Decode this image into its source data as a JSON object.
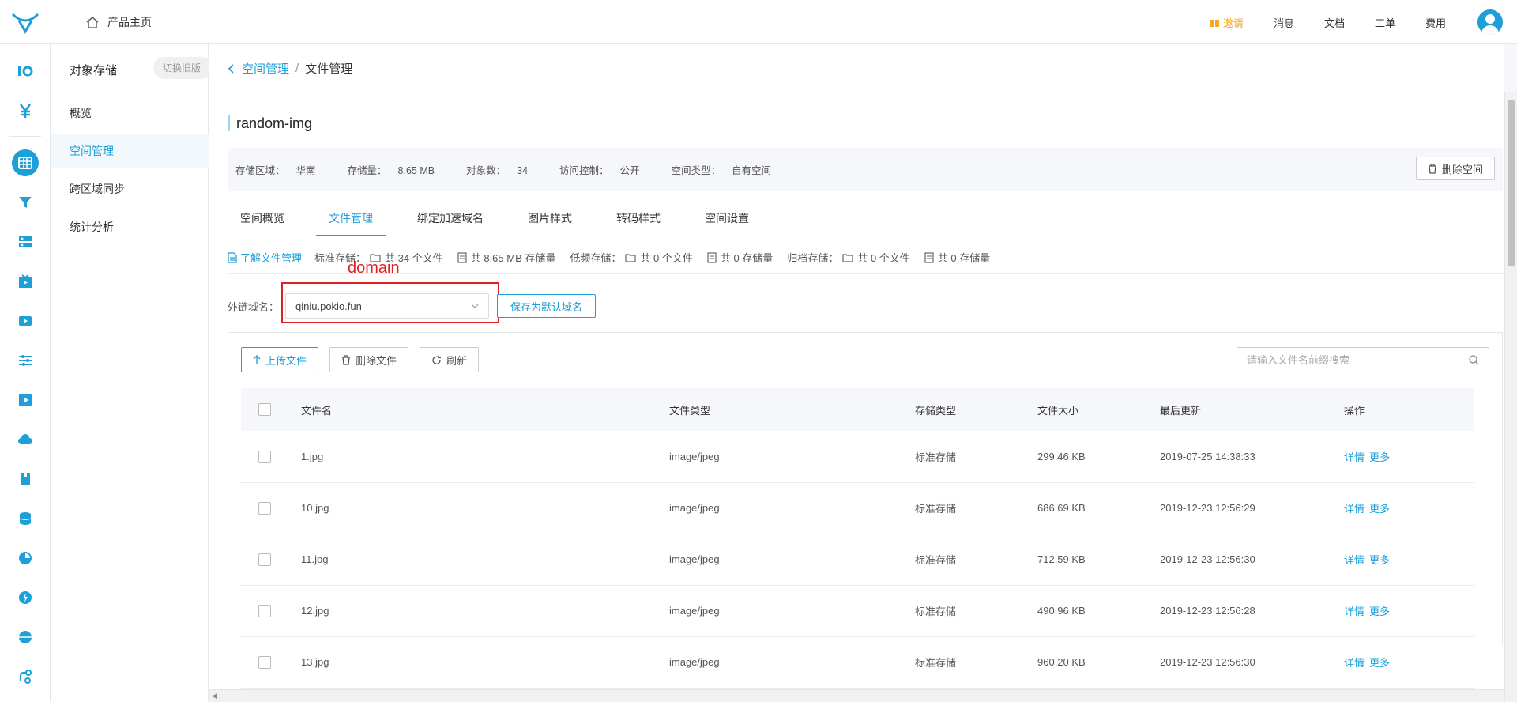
{
  "topbar": {
    "home_label": "产品主页",
    "invite_label": "邀请",
    "messages_label": "消息",
    "docs_label": "文档",
    "ticket_label": "工单",
    "billing_label": "费用"
  },
  "sidebar": {
    "title": "对象存储",
    "switch_label": "切换旧版",
    "items": [
      {
        "label": "概览"
      },
      {
        "label": "空间管理"
      },
      {
        "label": "跨区域同步"
      },
      {
        "label": "统计分析"
      }
    ]
  },
  "breadcrumb": {
    "parent": "空间管理",
    "separator": "/",
    "current": "文件管理"
  },
  "bucket": {
    "name": "random-img",
    "region_label": "存储区域：",
    "region_value": "华南",
    "storage_label": "存储量：",
    "storage_value": "8.65 MB",
    "objects_label": "对象数：",
    "objects_value": "34",
    "access_label": "访问控制：",
    "access_value": "公开",
    "type_label": "空间类型：",
    "type_value": "自有空间",
    "delete_button": "删除空间"
  },
  "tabs": [
    {
      "label": "空间概览"
    },
    {
      "label": "文件管理"
    },
    {
      "label": "绑定加速域名"
    },
    {
      "label": "图片样式"
    },
    {
      "label": "转码样式"
    },
    {
      "label": "空间设置"
    }
  ],
  "stats": {
    "learn_link": "了解文件管理",
    "standard_label": "标准存储：",
    "standard_files": "共 34 个文件",
    "standard_size": "共 8.65 MB 存储量",
    "low_label": "低频存储：",
    "low_files": "共 0 个文件",
    "low_size": "共 0 存储量",
    "archive_label": "归档存储：",
    "archive_files": "共 0 个文件",
    "archive_size": "共 0 存储量"
  },
  "domain": {
    "annotation": "domain",
    "label": "外链域名：",
    "value": "qiniu.pokio.fun",
    "save_default_button": "保存为默认域名"
  },
  "toolbar": {
    "upload_label": "上传文件",
    "delete_label": "删除文件",
    "refresh_label": "刷新",
    "search_placeholder": "请输入文件名前缀搜索"
  },
  "table": {
    "headers": [
      "文件名",
      "文件类型",
      "存储类型",
      "文件大小",
      "最后更新",
      "操作"
    ],
    "rows": [
      {
        "name": "1.jpg",
        "type": "image/jpeg",
        "storage": "标准存储",
        "size": "299.46 KB",
        "updated": "2019-07-25 14:38:33",
        "op_detail": "详情",
        "op_more": "更多"
      },
      {
        "name": "10.jpg",
        "type": "image/jpeg",
        "storage": "标准存储",
        "size": "686.69 KB",
        "updated": "2019-12-23 12:56:29",
        "op_detail": "详情",
        "op_more": "更多"
      },
      {
        "name": "11.jpg",
        "type": "image/jpeg",
        "storage": "标准存储",
        "size": "712.59 KB",
        "updated": "2019-12-23 12:56:30",
        "op_detail": "详情",
        "op_more": "更多"
      },
      {
        "name": "12.jpg",
        "type": "image/jpeg",
        "storage": "标准存储",
        "size": "490.96 KB",
        "updated": "2019-12-23 12:56:28",
        "op_detail": "详情",
        "op_more": "更多"
      },
      {
        "name": "13.jpg",
        "type": "image/jpeg",
        "storage": "标准存储",
        "size": "960.20 KB",
        "updated": "2019-12-23 12:56:30",
        "op_detail": "详情",
        "op_more": "更多"
      }
    ]
  },
  "colors": {
    "accent": "#1e9fd8",
    "invite": "#f5a623",
    "annotation_red": "#e02020"
  }
}
